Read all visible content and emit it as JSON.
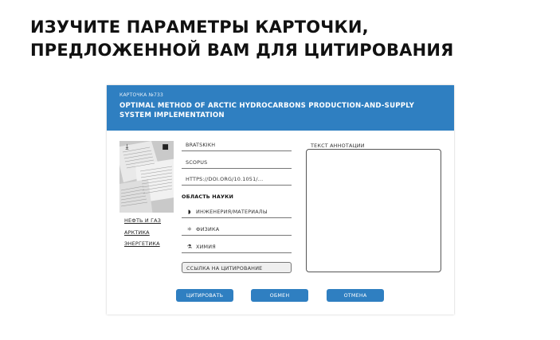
{
  "heading": {
    "line1": "ИЗУЧИТЕ ПАРАМЕТРЫ КАРТОЧКИ,",
    "line2": "ПРЕДЛОЖЕННОЙ ВАМ ДЛЯ ЦИТИРОВАНИЯ"
  },
  "card": {
    "number": "КАРТОЧКА №733",
    "title": "OPTIMAL METHOD OF ARCTIC HYDROCARBONS PRODUCTION-AND-SUPPLY SYSTEM IMPLEMENTATION",
    "header_color": "#2f7fc1",
    "thumbnail_icons": [
      "download-icon",
      "bookmark-icon"
    ],
    "tags": [
      "НЕФТЬ И ГАЗ",
      "АРКТИКА",
      "ЭНЕРГЕТИКА"
    ],
    "author": "BRATSKIKH",
    "database": "SCOPUS",
    "doi": "HTTPS://DOI.ORG/10.1051/...",
    "science_area_label": "ОБЛАСТЬ НАУКИ",
    "science_areas": [
      {
        "icon": "gear-icon",
        "label": "ИНЖЕНЕРИЯ/МАТЕРИАЛЫ"
      },
      {
        "icon": "atom-icon",
        "label": "ФИЗИКА"
      },
      {
        "icon": "flask-icon",
        "label": "ХИМИЯ"
      }
    ],
    "citation_link": "ССЫЛКА НА ЦИТИРОВАНИЕ",
    "annotation_label": "ТЕКСТ АННОТАЦИИ",
    "annotation_text": ""
  },
  "buttons": {
    "cite": "ЦИТИРОВАТЬ",
    "exchange": "ОБМЕН",
    "cancel": "ОТМЕНА"
  }
}
